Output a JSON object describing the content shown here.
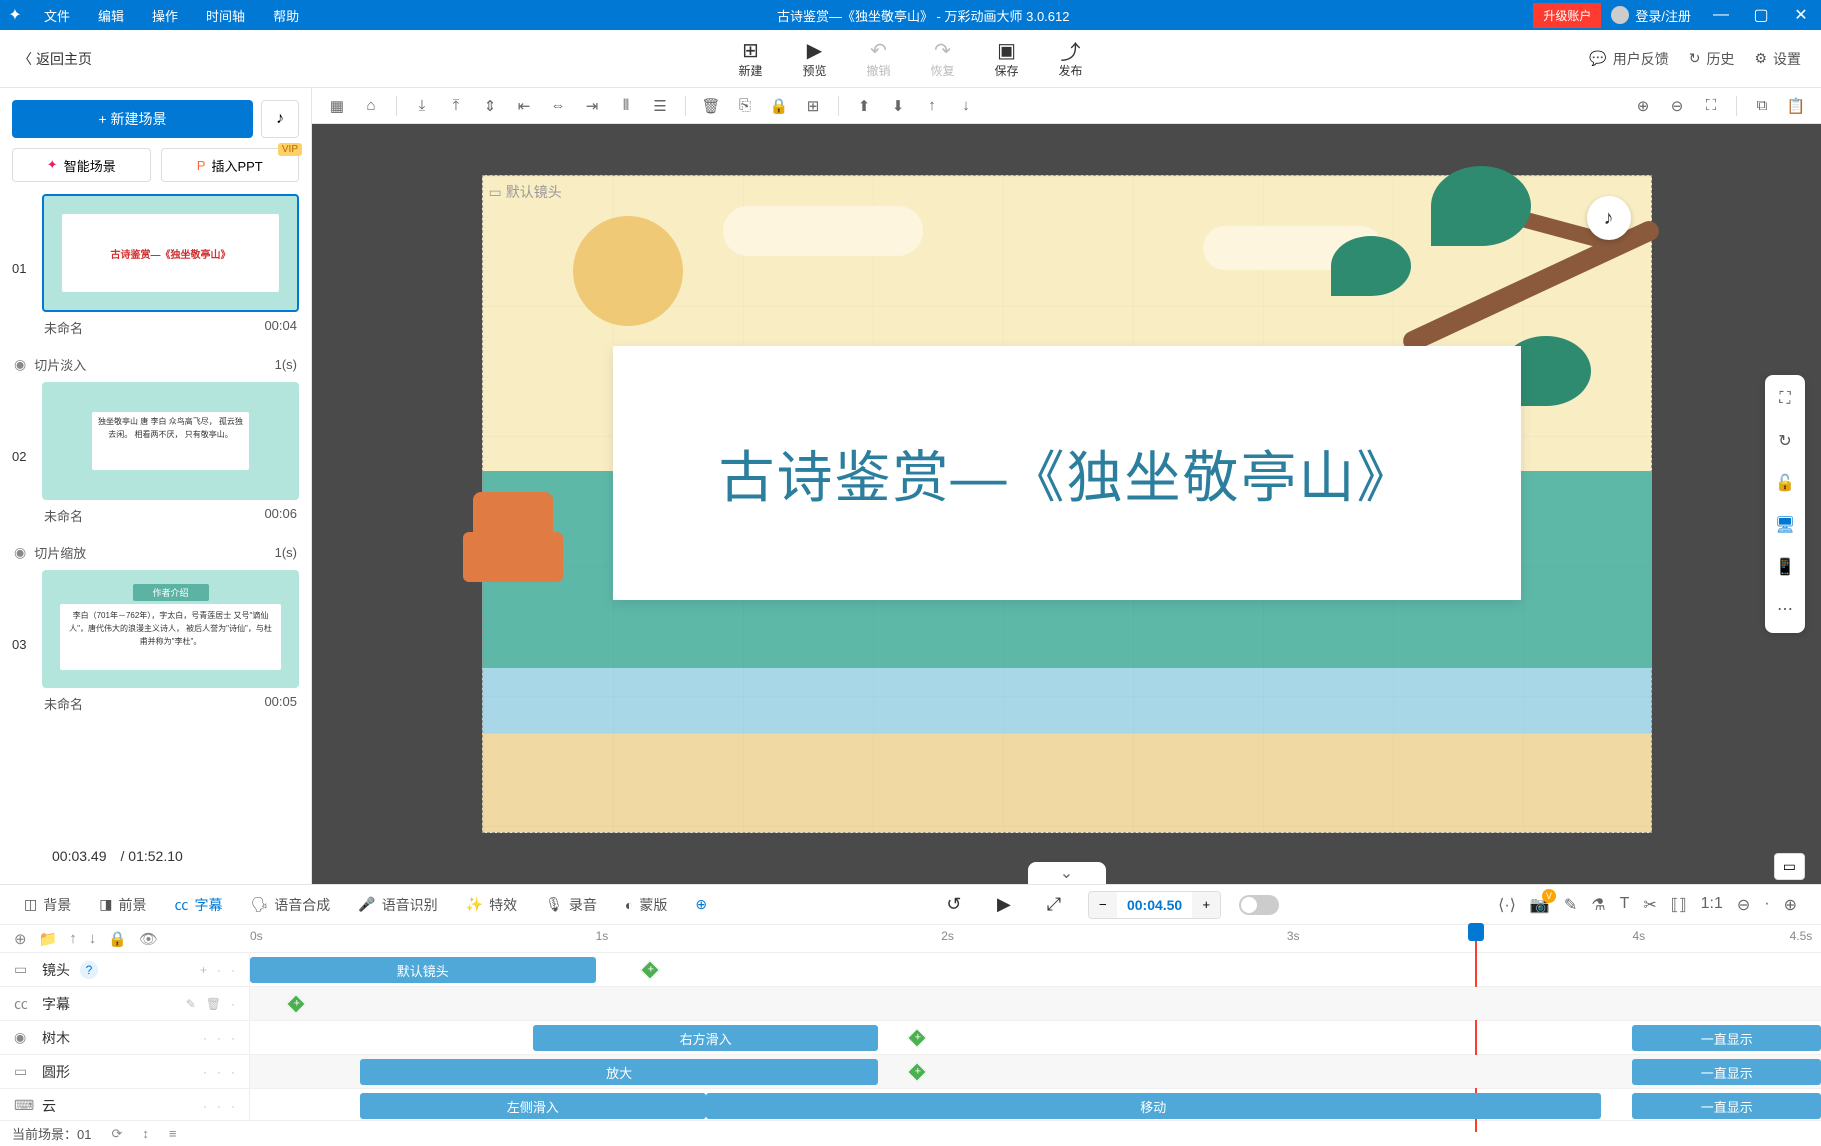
{
  "titlebar": {
    "menus": [
      "文件",
      "编辑",
      "操作",
      "时间轴",
      "帮助"
    ],
    "title": "古诗鉴赏—《独坐敬亭山》 - 万彩动画大师 3.0.612",
    "upgrade": "升级账户",
    "login": "登录/注册"
  },
  "topbar": {
    "back": "返回主页",
    "actions": {
      "new": "新建",
      "preview": "预览",
      "undo": "撤销",
      "redo": "恢复",
      "save": "保存",
      "publish": "发布"
    },
    "right": {
      "feedback": "用户反馈",
      "history": "历史",
      "settings": "设置"
    }
  },
  "left": {
    "new_scene": "+  新建场景",
    "ai_scene": "智能场景",
    "insert_ppt": "插入PPT",
    "vip": "VIP",
    "scenes": [
      {
        "num": "01",
        "name": "未命名",
        "dur": "00:04",
        "thumb_text": "古诗鉴赏—《独坐敬亭山》"
      },
      {
        "num": "02",
        "name": "未命名",
        "dur": "00:06",
        "thumb_text": "独坐敬亭山\n唐 李白\n众鸟高飞尽，\n孤云独去闲。\n相看两不厌，\n只有敬亭山。"
      },
      {
        "num": "03",
        "name": "未命名",
        "dur": "00:05",
        "thumb_top": "作者介绍",
        "thumb_text": "李白（701年－762年），字太白，号青莲居士\n又号\"谪仙人\"，唐代伟大的浪漫主义诗人，\n被后人誉为\"诗仙\"，与杜甫并称为\"李杜\"。"
      }
    ],
    "transitions": [
      {
        "name": "切片淡入",
        "dur": "1(s)"
      },
      {
        "name": "切片缩放",
        "dur": "1(s)"
      }
    ],
    "time_current": "00:03.49",
    "time_total": "/ 01:52.10"
  },
  "canvas": {
    "camera_label": "默认镜头",
    "title_text": "古诗鉴赏—《独坐敬亭山》"
  },
  "timeline": {
    "tabs": {
      "bg": "背景",
      "fg": "前景",
      "subtitle": "字幕",
      "tts": "语音合成",
      "asr": "语音识别",
      "effect": "特效",
      "record": "录音",
      "mask": "蒙版"
    },
    "playtime": "00:04.50",
    "ruler": [
      "0s",
      "1s",
      "2s",
      "3s",
      "4s",
      "4.5s"
    ],
    "tracks": {
      "camera": "镜头",
      "subtitle": "字幕",
      "tree": "树木",
      "circle": "圆形",
      "cloud": "云"
    },
    "clips": {
      "default_camera": "默认镜头",
      "slide_right": "右方滑入",
      "zoom": "放大",
      "slide_left": "左侧滑入",
      "move": "移动",
      "always_show": "一直显示"
    }
  },
  "status": {
    "current_scene": "当前场景：01"
  }
}
